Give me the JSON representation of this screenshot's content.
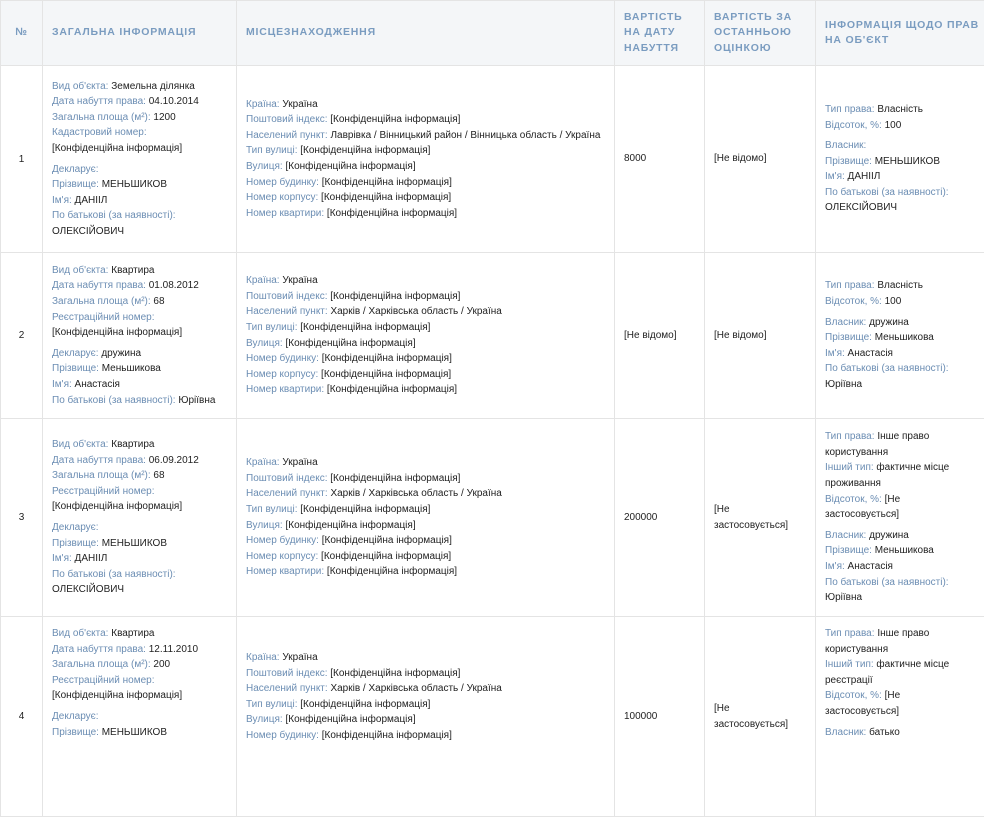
{
  "headers": [
    "№",
    "Загальна інформація",
    "Місцезнаходження",
    "Вартість на дату набуття",
    "Вартість за останньою оцінкою",
    "Інформація щодо прав на об'єкт"
  ],
  "rows": [
    {
      "num": "1",
      "general": [
        {
          "label": "Вид об'єкта:",
          "value": "Земельна ділянка"
        },
        {
          "label": "Дата набуття права:",
          "value": "04.10.2014"
        },
        {
          "label": "Загальна площа (м²):",
          "value": "1200"
        },
        {
          "label": "Кадастровий номер:",
          "value": ""
        },
        {
          "label": "",
          "value": "[Конфіденційна інформація]"
        },
        {
          "label": "Декларує:",
          "value": "",
          "gap": true
        },
        {
          "label": "Прізвище:",
          "value": "МЕНЬШИКОВ"
        },
        {
          "label": "Ім'я:",
          "value": "ДАНІІЛ"
        },
        {
          "label": "По батькові (за наявності):",
          "value": ""
        },
        {
          "label": "",
          "value": "ОЛЕКСІЙОВИЧ"
        }
      ],
      "location": [
        {
          "label": "Країна:",
          "value": "Україна"
        },
        {
          "label": "Поштовий індекс:",
          "value": "[Конфіденційна інформація]"
        },
        {
          "label": "Населений пункт:",
          "value": "Лаврівка / Вінницький район / Вінницька область / Україна"
        },
        {
          "label": "Тип вулиці:",
          "value": "[Конфіденційна інформація]"
        },
        {
          "label": "Вулиця:",
          "value": "[Конфіденційна інформація]"
        },
        {
          "label": "Номер будинку:",
          "value": "[Конфіденційна інформація]"
        },
        {
          "label": "Номер корпусу:",
          "value": "[Конфіденційна інформація]"
        },
        {
          "label": "Номер квартири:",
          "value": "[Конфіденційна інформація]"
        }
      ],
      "cost_acq": "8000",
      "cost_last": "[Не відомо]",
      "rights": [
        {
          "label": "Тип права:",
          "value": "Власність"
        },
        {
          "label": "Відсоток, %:",
          "value": "100"
        },
        {
          "label": "Власник:",
          "value": "",
          "gap": true
        },
        {
          "label": "Прізвище:",
          "value": "МЕНЬШИКОВ"
        },
        {
          "label": "Ім'я:",
          "value": "ДАНІІЛ"
        },
        {
          "label": "По батькові (за наявності):",
          "value": ""
        },
        {
          "label": "",
          "value": "ОЛЕКСІЙОВИЧ"
        }
      ]
    },
    {
      "num": "2",
      "general": [
        {
          "label": "Вид об'єкта:",
          "value": "Квартира"
        },
        {
          "label": "Дата набуття права:",
          "value": "01.08.2012"
        },
        {
          "label": "Загальна площа (м²):",
          "value": "68"
        },
        {
          "label": "Реєстраційний номер:",
          "value": ""
        },
        {
          "label": "",
          "value": "[Конфіденційна інформація]"
        },
        {
          "label": "Декларує:",
          "value": "дружина",
          "gap": true
        },
        {
          "label": "Прізвище:",
          "value": "Меньшикова"
        },
        {
          "label": "Ім'я:",
          "value": "Анастасія"
        },
        {
          "label": "По батькові (за наявності):",
          "value": "Юріївна"
        }
      ],
      "location": [
        {
          "label": "Країна:",
          "value": "Україна"
        },
        {
          "label": "Поштовий індекс:",
          "value": "[Конфіденційна інформація]"
        },
        {
          "label": "Населений пункт:",
          "value": "Харків / Харківська область / Україна"
        },
        {
          "label": "Тип вулиці:",
          "value": "[Конфіденційна інформація]"
        },
        {
          "label": "Вулиця:",
          "value": "[Конфіденційна інформація]"
        },
        {
          "label": "Номер будинку:",
          "value": "[Конфіденційна інформація]"
        },
        {
          "label": "Номер корпусу:",
          "value": "[Конфіденційна інформація]"
        },
        {
          "label": "Номер квартири:",
          "value": "[Конфіденційна інформація]"
        }
      ],
      "cost_acq": "[Не відомо]",
      "cost_last": "[Не відомо]",
      "rights": [
        {
          "label": "Тип права:",
          "value": "Власність"
        },
        {
          "label": "Відсоток, %:",
          "value": "100"
        },
        {
          "label": "Власник:",
          "value": "дружина",
          "gap": true
        },
        {
          "label": "Прізвище:",
          "value": "Меньшикова"
        },
        {
          "label": "Ім'я:",
          "value": "Анастасія"
        },
        {
          "label": "По батькові (за наявності):",
          "value": ""
        },
        {
          "label": "",
          "value": "Юріївна"
        }
      ]
    },
    {
      "num": "3",
      "general": [
        {
          "label": "Вид об'єкта:",
          "value": "Квартира"
        },
        {
          "label": "Дата набуття права:",
          "value": "06.09.2012"
        },
        {
          "label": "Загальна площа (м²):",
          "value": "68"
        },
        {
          "label": "Реєстраційний номер:",
          "value": ""
        },
        {
          "label": "",
          "value": "[Конфіденційна інформація]"
        },
        {
          "label": "Декларує:",
          "value": "",
          "gap": true
        },
        {
          "label": "Прізвище:",
          "value": "МЕНЬШИКОВ"
        },
        {
          "label": "Ім'я:",
          "value": "ДАНІІЛ"
        },
        {
          "label": "По батькові (за наявності):",
          "value": ""
        },
        {
          "label": "",
          "value": "ОЛЕКСІЙОВИЧ"
        }
      ],
      "location": [
        {
          "label": "Країна:",
          "value": "Україна"
        },
        {
          "label": "Поштовий індекс:",
          "value": "[Конфіденційна інформація]"
        },
        {
          "label": "Населений пункт:",
          "value": "Харків / Харківська область / Україна"
        },
        {
          "label": "Тип вулиці:",
          "value": "[Конфіденційна інформація]"
        },
        {
          "label": "Вулиця:",
          "value": "[Конфіденційна інформація]"
        },
        {
          "label": "Номер будинку:",
          "value": "[Конфіденційна інформація]"
        },
        {
          "label": "Номер корпусу:",
          "value": "[Конфіденційна інформація]"
        },
        {
          "label": "Номер квартири:",
          "value": "[Конфіденційна інформація]"
        }
      ],
      "cost_acq": "200000",
      "cost_last": "[Не застосовується]",
      "rights": [
        {
          "label": "Тип права:",
          "value": "Інше право"
        },
        {
          "label": "",
          "value": "користування"
        },
        {
          "label": "Інший тип:",
          "value": "фактичне місце"
        },
        {
          "label": "",
          "value": "проживання"
        },
        {
          "label": "Відсоток, %:",
          "value": "[Не"
        },
        {
          "label": "",
          "value": "застосовується]"
        },
        {
          "label": "Власник:",
          "value": "дружина",
          "gap": true
        },
        {
          "label": "Прізвище:",
          "value": "Меньшикова"
        },
        {
          "label": "Ім'я:",
          "value": "Анастасія"
        },
        {
          "label": "По батькові (за наявності):",
          "value": ""
        },
        {
          "label": "",
          "value": "Юріївна"
        }
      ]
    },
    {
      "num": "4",
      "general": [
        {
          "label": "Вид об'єкта:",
          "value": "Квартира"
        },
        {
          "label": "Дата набуття права:",
          "value": "12.11.2010"
        },
        {
          "label": "Загальна площа (м²):",
          "value": "200"
        },
        {
          "label": "Реєстраційний номер:",
          "value": ""
        },
        {
          "label": "",
          "value": "[Конфіденційна інформація]"
        },
        {
          "label": "Декларує:",
          "value": "",
          "gap": true
        },
        {
          "label": "Прізвище:",
          "value": "МЕНЬШИКОВ"
        }
      ],
      "location": [
        {
          "label": "Країна:",
          "value": "Україна"
        },
        {
          "label": "Поштовий індекс:",
          "value": "[Конфіденційна інформація]"
        },
        {
          "label": "Населений пункт:",
          "value": "Харків / Харківська область / Україна"
        },
        {
          "label": "Тип вулиці:",
          "value": "[Конфіденційна інформація]"
        },
        {
          "label": "Вулиця:",
          "value": "[Конфіденційна інформація]"
        },
        {
          "label": "Номер будинку:",
          "value": "[Конфіденційна інформація]"
        }
      ],
      "cost_acq": "100000",
      "cost_last": "[Не застосовується]",
      "rights": [
        {
          "label": "Тип права:",
          "value": "Інше право"
        },
        {
          "label": "",
          "value": "користування"
        },
        {
          "label": "Інший тип:",
          "value": "фактичне місце"
        },
        {
          "label": "",
          "value": "реєстрації"
        },
        {
          "label": "Відсоток, %:",
          "value": "[Не"
        },
        {
          "label": "",
          "value": "застосовується]"
        },
        {
          "label": "Власник:",
          "value": "батько",
          "gap": true
        }
      ]
    }
  ]
}
